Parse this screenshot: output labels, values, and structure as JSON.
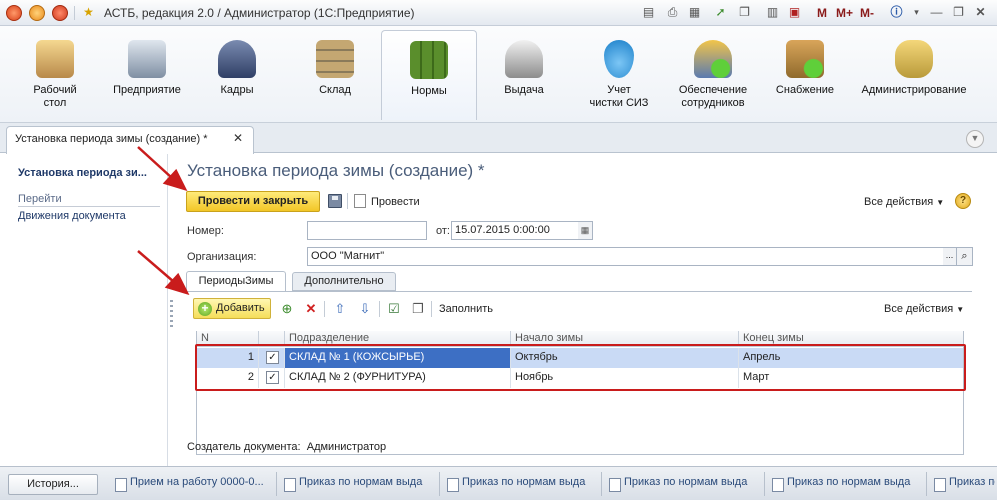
{
  "window": {
    "title": "АСТБ, редакция 2.0 / Администратор (1С:Предприятие)",
    "memory_buttons": [
      "M",
      "M+",
      "M-"
    ]
  },
  "ribbon": {
    "items": [
      {
        "label": "Рабочий\nстол",
        "icon": "desk-icon"
      },
      {
        "label": "Предприятие",
        "icon": "building-icon"
      },
      {
        "label": "Кадры",
        "icon": "people-icon"
      },
      {
        "label": "Склад",
        "icon": "warehouse-icon"
      },
      {
        "label": "Нормы",
        "icon": "binders-icon",
        "active": true
      },
      {
        "label": "Выдача",
        "icon": "worker-icon"
      },
      {
        "label": "Учет\nчистки СИЗ",
        "icon": "cleaning-icon"
      },
      {
        "label": "Обеспечение\nсотрудников",
        "icon": "user-add-icon"
      },
      {
        "label": "Снабжение",
        "icon": "box-add-icon"
      },
      {
        "label": "Администрирование",
        "icon": "admin-icon"
      }
    ]
  },
  "doc_tab": {
    "label": "Установка периода зимы (создание) *"
  },
  "left_nav": {
    "current": "Установка периода зи...",
    "goto_header": "Перейти",
    "movements": "Движения документа"
  },
  "form": {
    "title": "Установка периода зимы (создание) *",
    "post_close_label": "Провести и закрыть",
    "post_label": "Провести",
    "all_actions": "Все действия",
    "number_label": "Номер:",
    "number_value": "",
    "date_label": "от:",
    "date_value": "15.07.2015  0:00:00",
    "org_label": "Организация:",
    "org_value": "ООО \"Магнит\"",
    "author_label": "Создатель документа:",
    "author_value": "Администратор"
  },
  "inner_tabs": [
    "ПериодыЗимы",
    "Дополнительно"
  ],
  "table_toolbar": {
    "add_label": "Добавить",
    "fill_label": "Заполнить",
    "all_actions": "Все действия"
  },
  "table": {
    "columns": [
      "N",
      "",
      "Подразделение",
      "Начало зимы",
      "Конец зимы"
    ],
    "rows": [
      {
        "n": "1",
        "checked": true,
        "division": "СКЛАД № 1 (КОЖСЫРЬЕ)",
        "start": "Октябрь",
        "end": "Апрель"
      },
      {
        "n": "2",
        "checked": true,
        "division": "СКЛАД № 2 (ФУРНИТУРА)",
        "start": "Ноябрь",
        "end": "Март"
      }
    ]
  },
  "taskbar": {
    "history_label": "История...",
    "tasks": [
      "Прием на работу 0000-0...",
      "Приказ по нормам выда...",
      "Приказ по нормам выда...",
      "Приказ по нормам выда...",
      "Приказ по нормам выда...",
      "Приказ по нормам выда..."
    ]
  },
  "colors": {
    "accent_yellow": "#f2c627",
    "highlight_red": "#c91c1c",
    "title_blue": "#4a5d7a",
    "selected_row": "#c9daf5"
  }
}
